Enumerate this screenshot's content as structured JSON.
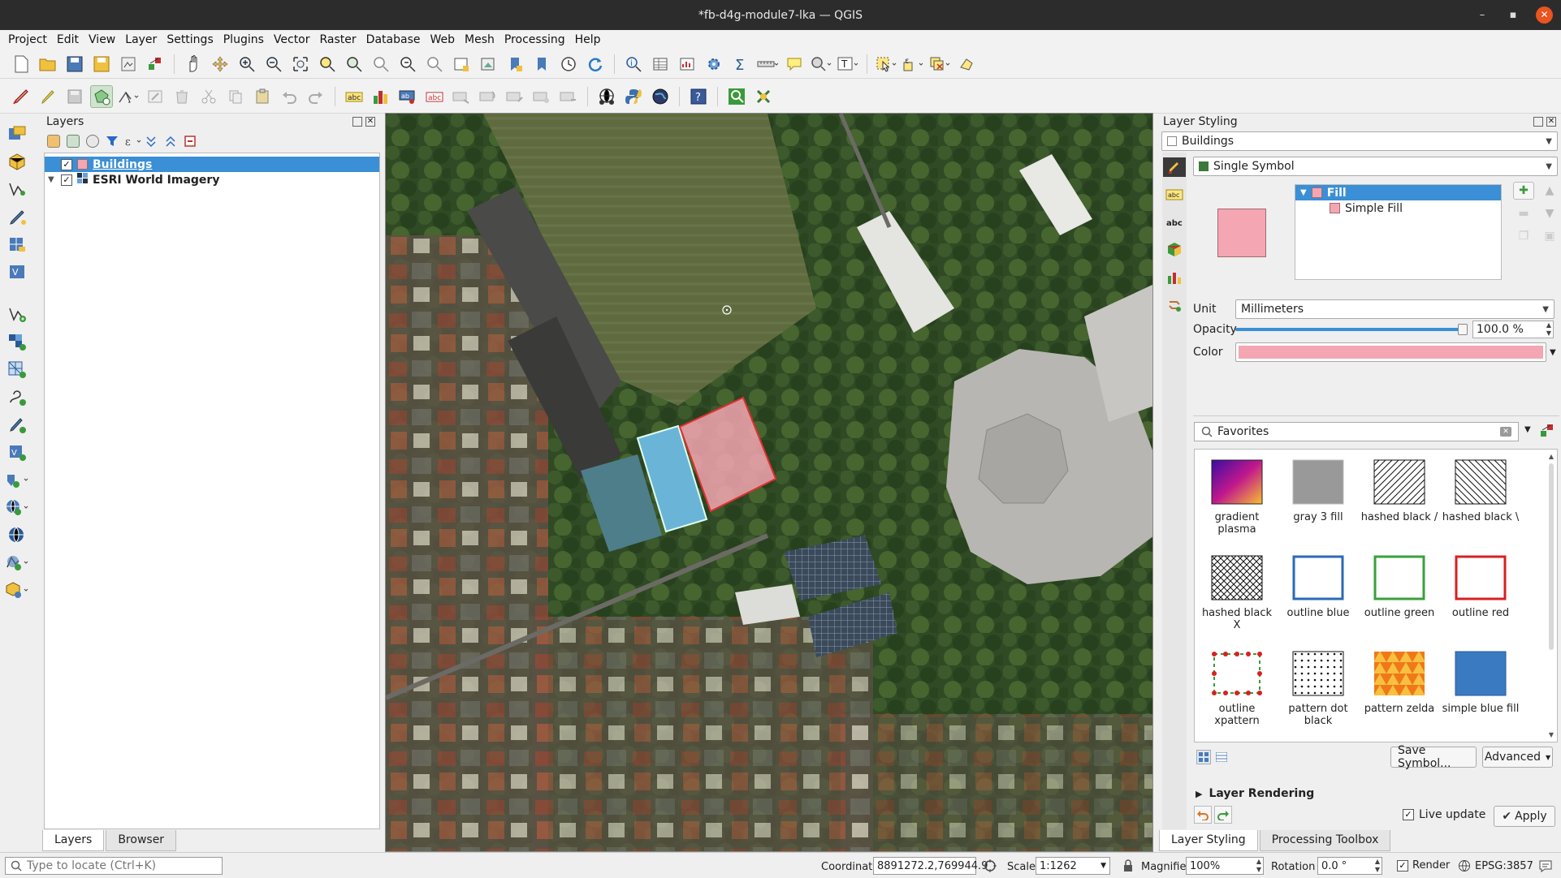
{
  "window": {
    "title": "*fb-d4g-module7-lka — QGIS",
    "minimize": "–",
    "maximize": "▪",
    "close": "✕"
  },
  "menu": [
    "Project",
    "Edit",
    "View",
    "Layer",
    "Settings",
    "Plugins",
    "Vector",
    "Raster",
    "Database",
    "Web",
    "Mesh",
    "Processing",
    "Help"
  ],
  "layers_panel": {
    "title": "Layers",
    "layers": [
      {
        "name": "Buildings",
        "checked": "✓",
        "selected": true
      },
      {
        "name": "ESRI World Imagery",
        "checked": "✓",
        "selected": false
      }
    ],
    "tabs": [
      "Layers",
      "Browser"
    ]
  },
  "styling_panel": {
    "title": "Layer Styling",
    "layer_combo": "Buildings",
    "renderer_combo": "Single Symbol",
    "symbol_tree": [
      {
        "label": "Fill",
        "selected": true
      },
      {
        "label": "Simple Fill",
        "selected": false
      }
    ],
    "unit_label": "Unit",
    "unit_value": "Millimeters",
    "opacity_label": "Opacity",
    "opacity_value": "100.0 %",
    "opacity_fraction": 1.0,
    "color_label": "Color",
    "fill_color": "#f4a6b2",
    "search_value": "Favorites",
    "favorites": [
      {
        "name": "gradient plasma",
        "style": "gradient"
      },
      {
        "name": "gray 3 fill",
        "style": "gray"
      },
      {
        "name": "hashed black /",
        "style": "hash-fwd"
      },
      {
        "name": "hashed black \\",
        "style": "hash-back"
      },
      {
        "name": "hashed black X",
        "style": "hash-x"
      },
      {
        "name": "outline blue",
        "style": "outline-blue"
      },
      {
        "name": "outline green",
        "style": "outline-green"
      },
      {
        "name": "outline red",
        "style": "outline-red"
      },
      {
        "name": "outline xpattern",
        "style": "outline-x"
      },
      {
        "name": "pattern dot black",
        "style": "dots"
      },
      {
        "name": "pattern zelda",
        "style": "zelda"
      },
      {
        "name": "simple blue fill",
        "style": "blue-fill"
      }
    ],
    "save_symbol": "Save Symbol...",
    "advanced": "Advanced",
    "layer_rendering": "Layer Rendering",
    "live_update": "Live update",
    "apply": "Apply",
    "tabs": [
      "Layer Styling",
      "Processing Toolbox"
    ]
  },
  "statusbar": {
    "locate_placeholder": "Type to locate (Ctrl+K)",
    "coordinate_label": "Coordinate",
    "coordinate_value": "8891272.2,769944.9",
    "scale_label": "Scale",
    "scale_value": "1:1262",
    "magnifier_label": "Magnifier",
    "magnifier_value": "100%",
    "rotation_label": "Rotation",
    "rotation_value": "0.0 °",
    "render_label": "Render",
    "crs": "EPSG:3857"
  },
  "colors": {
    "selection": "#3a8fd6",
    "building_fill": "#f4a6b2",
    "building_outline": "#e03030"
  }
}
